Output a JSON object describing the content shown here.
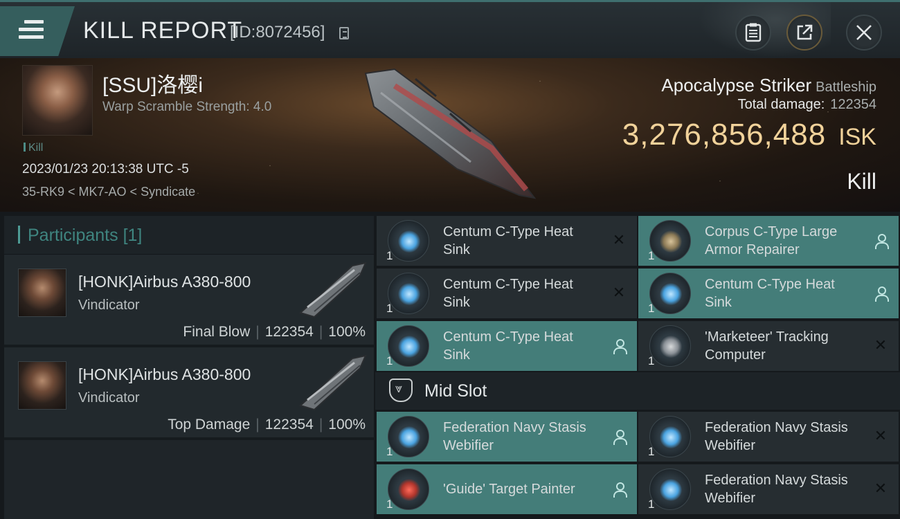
{
  "header": {
    "title": "KILL REPORT",
    "report_id": "[ID:8072456]",
    "icons": [
      "menu-icon",
      "copy-icon",
      "clipboard-icon",
      "share-icon",
      "close-icon"
    ]
  },
  "victim": {
    "name": "[SSU]洛樱i",
    "warp_scramble": "Warp Scramble Strength: 4.0",
    "kill_tag": "Kill",
    "timestamp": "2023/01/23 20:13:38 UTC -5",
    "location": "35-RK9 < MK7-AO < Syndicate",
    "ship_name": "Apocalypse Striker",
    "ship_class": "Battleship",
    "total_damage_label": "Total damage:",
    "total_damage_value": "122354",
    "isk_value": "3,276,856,488",
    "isk_unit": "ISK",
    "result": "Kill"
  },
  "participants": {
    "title": "Participants",
    "count": "[1]",
    "rows": [
      {
        "name": "[HONK]Airbus A380-800",
        "ship": "Vindicator",
        "role": "Final Blow",
        "damage": "122354",
        "percent": "100%"
      },
      {
        "name": "[HONK]Airbus A380-800",
        "ship": "Vindicator",
        "role": "Top Damage",
        "damage": "122354",
        "percent": "100%"
      }
    ]
  },
  "modules": {
    "items": [
      {
        "name": "Centum C-Type Heat Sink",
        "qty": "1",
        "status": "destroyed",
        "icon": "heat-sink-icon"
      },
      {
        "name": "Corpus C-Type Large Armor Repairer",
        "qty": "1",
        "status": "dropped",
        "icon": "armor-repairer-icon"
      },
      {
        "name": "Centum C-Type Heat Sink",
        "qty": "1",
        "status": "destroyed",
        "icon": "heat-sink-icon"
      },
      {
        "name": "Centum C-Type Heat Sink",
        "qty": "1",
        "status": "dropped",
        "icon": "heat-sink-icon"
      },
      {
        "name": "Centum C-Type Heat Sink",
        "qty": "1",
        "status": "dropped",
        "icon": "heat-sink-icon"
      },
      {
        "name": "'Marketeer' Tracking Computer",
        "qty": "1",
        "status": "destroyed",
        "icon": "tracking-computer-icon"
      }
    ],
    "mid_slot_title": "Mid Slot",
    "mid_items": [
      {
        "name": "Federation Navy Stasis Webifier",
        "qty": "1",
        "status": "dropped",
        "icon": "stasis-webifier-icon"
      },
      {
        "name": "Federation Navy Stasis Webifier",
        "qty": "1",
        "status": "destroyed",
        "icon": "stasis-webifier-icon"
      },
      {
        "name": "'Guide' Target Painter",
        "qty": "1",
        "status": "dropped",
        "icon": "target-painter-icon"
      },
      {
        "name": "Federation Navy Stasis Webifier",
        "qty": "1",
        "status": "destroyed",
        "icon": "stasis-webifier-icon"
      }
    ]
  },
  "colors": {
    "accent_teal": "#447d79",
    "isk_gold": "#f1d29a",
    "panel_dark": "#262d31"
  }
}
